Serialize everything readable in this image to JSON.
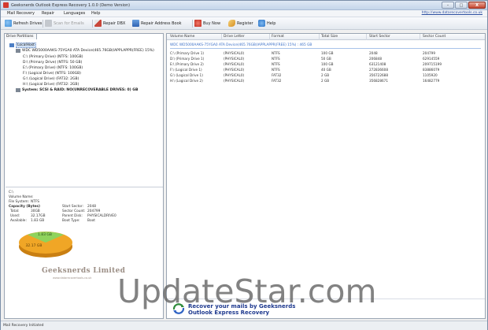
{
  "window": {
    "title": "Geeksnerds Outlook Express Recovery 1.0.0 (Demo Version)",
    "minimize_glyph": "–",
    "maximize_glyph": "□",
    "close_glyph": "X"
  },
  "menu": {
    "items": [
      "Mail Recovery",
      "Repair",
      "Languages",
      "Help"
    ],
    "site_link": "http://www.datarecovertools.co.uk"
  },
  "toolbar": {
    "buttons": [
      {
        "label": "Refresh Drives",
        "icon": "refresh-icon",
        "color": "#3f8fd8",
        "enabled": true
      },
      {
        "label": "Scan for Emails",
        "icon": "scan-icon",
        "color": "#b9bec6",
        "enabled": false
      },
      {
        "label": "Repair DBX",
        "icon": "repair-dbx-icon",
        "color": "#c9473a",
        "enabled": true
      },
      {
        "label": "Repair Address Book",
        "icon": "address-book-icon",
        "color": "#3b78c9",
        "enabled": true
      },
      {
        "label": "Buy Now",
        "icon": "cart-icon",
        "color": "#d13a2c",
        "enabled": true
      },
      {
        "label": "Register",
        "icon": "key-icon",
        "color": "#e2a13a",
        "enabled": true
      },
      {
        "label": "Help",
        "icon": "help-icon",
        "color": "#3c8ad6",
        "enabled": true
      }
    ]
  },
  "left_panel": {
    "tab_label": "Drive Partitions",
    "tree": [
      {
        "label": "LocalHost",
        "level": 0,
        "selected": true,
        "bold": false,
        "icon": "computer-icon"
      },
      {
        "label": "WDC WD5000AAKS-75YGA0 ATA Device(465.76GB(IAPPLAPPR(FREE) 15%)",
        "level": 1,
        "selected": false,
        "bold": false,
        "icon": "disk-icon"
      },
      {
        "label": "C:\\ (Primary Drive) (NTFS: 100GB)",
        "level": 2,
        "selected": false,
        "bold": false,
        "icon": "partition-icon"
      },
      {
        "label": "D:\\ (Primary Drive) (NTFS: 50 GB)",
        "level": 2,
        "selected": false,
        "bold": false,
        "icon": "partition-icon"
      },
      {
        "label": "E:\\ (Primary Drive) (NTFS: 100GB)",
        "level": 2,
        "selected": false,
        "bold": false,
        "icon": "partition-icon"
      },
      {
        "label": "F:\\ (Logical Drive) (NTFS: 100GB)",
        "level": 2,
        "selected": false,
        "bold": false,
        "icon": "partition-icon"
      },
      {
        "label": "G:\\ (Logical Drive) (FAT32: 2GB)",
        "level": 2,
        "selected": false,
        "bold": false,
        "icon": "partition-icon"
      },
      {
        "label": "H:\\ (Logical Drive) (FAT32: 2GB)",
        "level": 2,
        "selected": false,
        "bold": false,
        "icon": "partition-icon"
      },
      {
        "label": "System: SCSI & RAID: NO(UNRECOVERABLE DRIVES: 0) GB",
        "level": 1,
        "selected": false,
        "bold": true,
        "icon": "disk-icon"
      }
    ],
    "info": {
      "drive": "C:\\",
      "volume_name_label": "Volume Name:",
      "file_system_label": "File System:",
      "file_system": "NTFS",
      "capacity_label": "Capacity (Bytes)",
      "total_label": "Total:",
      "total": "30GB",
      "used_label": "Used:",
      "used": "32.17GB",
      "available_label": "Available:",
      "available": "1.83 GB",
      "start_sector_label": "Start Sector:",
      "start_sector": "2048",
      "sector_count_label": "Sector Count:",
      "sector_count": "204799",
      "parent_disk_label": "Parent Disk:",
      "parent_disk": "PHYSICALDRIVE0",
      "boot_type_label": "Boot Type:",
      "boot_type": "Boot"
    },
    "pie": {
      "free_label": "1.83 GB",
      "used_label": "32.17 GB",
      "free_color": "#8fd35c",
      "used_color": "#f0a626"
    },
    "brand": "Geeksnerds Limited",
    "brand_sub": "www.datarecovertools.co.uk"
  },
  "table": {
    "columns": [
      "Volume Name",
      "Drive Letter",
      "Format",
      "Total Size",
      "Start Sector",
      "Sector Count"
    ],
    "group_label": "WDC WD5000AAKS-75YGA0 ATA Device(465.76GB(IAPPLAPPR(FREE) 15%) : 465 GB",
    "rows": [
      [
        "C:\\ (Primary Drive 1)",
        "(PHYSICAL0)",
        "NTFS",
        "100 GB",
        "2048",
        "204799"
      ],
      [
        "D:\\ (Primary Drive 1)",
        "(PHYSICAL0)",
        "NTFS",
        "50 GB",
        "206848",
        "62914559"
      ],
      [
        "E:\\ (Primary Drive 2)",
        "(PHYSICAL0)",
        "NTFS",
        "100 GB",
        "63121408",
        "209715199"
      ],
      [
        "F:\\ (Logical Drive 1)",
        "(PHYSICAL0)",
        "NTFS",
        "40 GB",
        "272836608",
        "83886079"
      ],
      [
        "G:\\ (Logical Drive 1)",
        "(PHYSICAL0)",
        "FAT32",
        "2 GB",
        "356722688",
        "1105920"
      ],
      [
        "H:\\ (Logical Drive 2)",
        "(PHYSICAL0)",
        "FAT32",
        "2 GB",
        "356828671",
        "16482779"
      ]
    ]
  },
  "banner": {
    "line1": "Recover your mails by Geeksnerds",
    "line2": "Outlook Express Recovery"
  },
  "watermark": "UpdateStar.com",
  "status": {
    "text": "Mail Recovery Initiated"
  }
}
